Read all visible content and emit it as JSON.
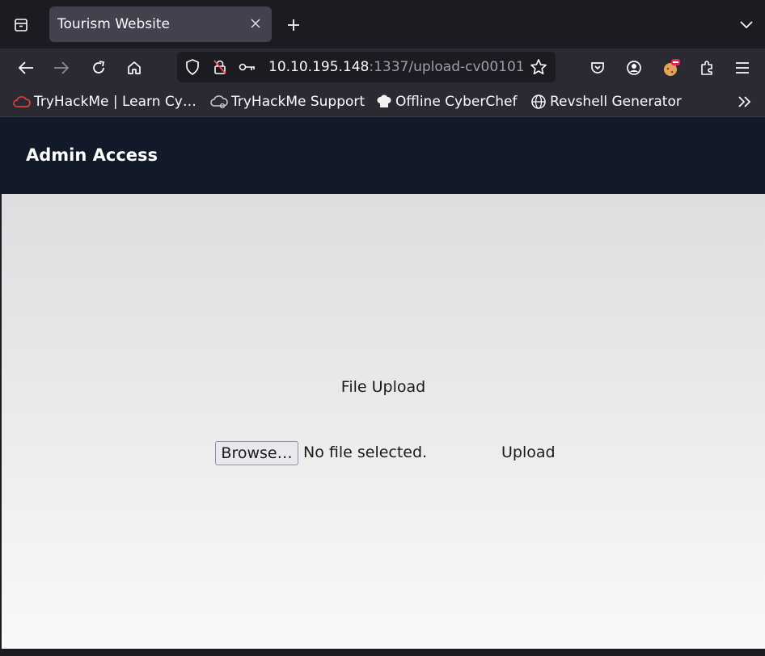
{
  "browser": {
    "tab": {
      "title": "Tourism Website"
    },
    "url": {
      "host": "10.10.195.148",
      "rest": ":1337/upload-cv00101"
    },
    "bookmarks": [
      {
        "label": "TryHackMe | Learn Cy…"
      },
      {
        "label": "TryHackMe Support"
      },
      {
        "label": "Offline CyberChef"
      },
      {
        "label": "Revshell Generator"
      }
    ]
  },
  "header": {
    "title": "Admin Access"
  },
  "upload": {
    "title": "File Upload",
    "browse_label": "Browse…",
    "file_status": "No file selected.",
    "upload_label": "Upload"
  }
}
